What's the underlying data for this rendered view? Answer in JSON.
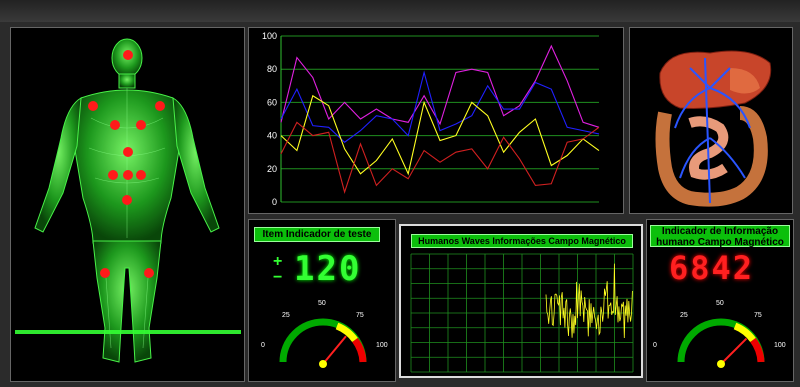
{
  "panels": {
    "test_indicator": {
      "title": "Item Indicador de teste",
      "value": "120",
      "plus": "+",
      "minus": "−"
    },
    "wave_monitor": {
      "title": "Humanos Waves Informações Campo Magnético"
    },
    "info_indicator": {
      "title_line1": "Indicador de Informação",
      "title_line2": "humano Campo Magnético",
      "value": "6842"
    }
  },
  "gauges": {
    "left": {
      "ticks": [
        "0",
        "25",
        "50",
        "75",
        "100"
      ],
      "level": 72
    },
    "right": {
      "ticks": [
        "0",
        "25",
        "50",
        "75",
        "100"
      ],
      "level": 75
    }
  },
  "colors": {
    "accent": "#00c800",
    "digit_green": "#33ff33",
    "digit_red": "#ff2020",
    "grid": "#1f8f1f"
  },
  "chart_data": {
    "type": "line",
    "ylim": [
      0,
      100
    ],
    "yticks": [
      "0",
      "20",
      "40",
      "60",
      "80",
      "100"
    ],
    "x": [
      0,
      1,
      2,
      3,
      4,
      5,
      6,
      7,
      8,
      9,
      10,
      11,
      12,
      13,
      14,
      15,
      16,
      17,
      18,
      19,
      20
    ],
    "series": [
      {
        "color": "#e020e0",
        "values": [
          48,
          87,
          75,
          50,
          60,
          50,
          56,
          50,
          48,
          64,
          47,
          78,
          80,
          78,
          52,
          58,
          73,
          94,
          73,
          48,
          45
        ]
      },
      {
        "color": "#2020ff",
        "values": [
          50,
          68,
          46,
          45,
          36,
          43,
          52,
          50,
          40,
          78,
          43,
          47,
          52,
          70,
          56,
          56,
          72,
          68,
          45,
          43,
          41
        ]
      },
      {
        "color": "#ffff20",
        "values": [
          40,
          31,
          64,
          58,
          32,
          17,
          25,
          38,
          17,
          60,
          37,
          40,
          60,
          52,
          30,
          42,
          50,
          22,
          28,
          38,
          31
        ]
      },
      {
        "color": "#d02020",
        "values": [
          29,
          48,
          40,
          42,
          6,
          35,
          10,
          20,
          14,
          31,
          24,
          30,
          32,
          20,
          39,
          26,
          10,
          11,
          36,
          38,
          45
        ]
      }
    ]
  }
}
